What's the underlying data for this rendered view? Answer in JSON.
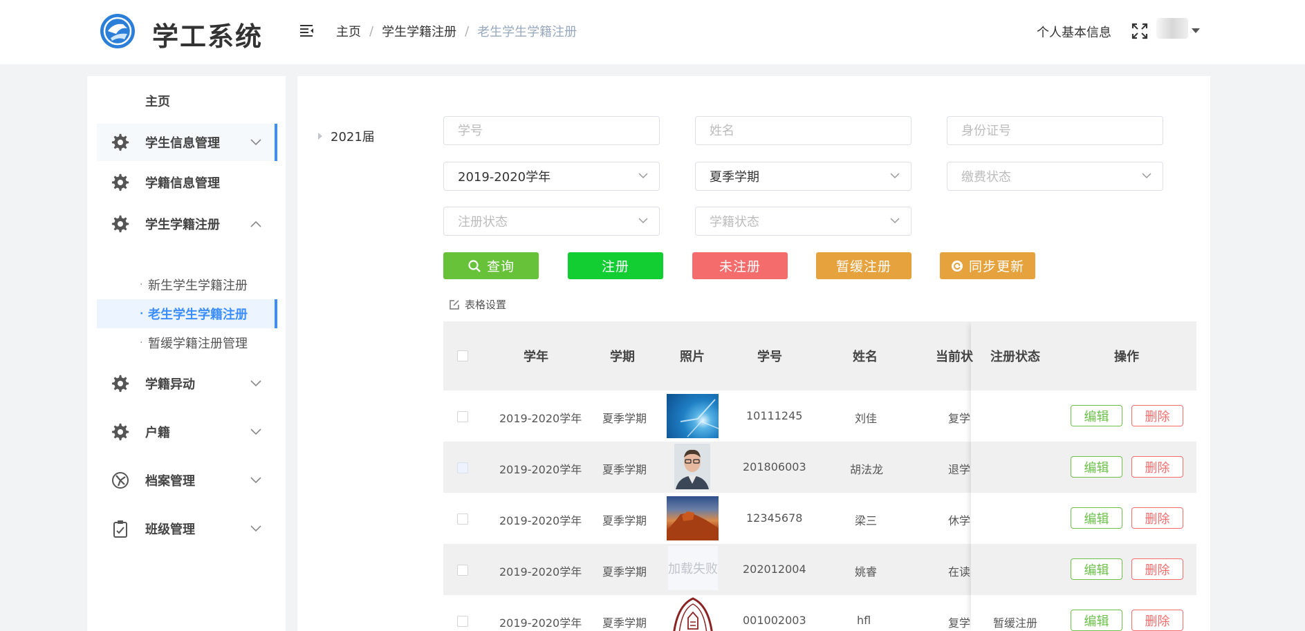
{
  "header": {
    "app_title": "学工系统",
    "breadcrumb": [
      "主页",
      "学生学籍注册",
      "老生学生学籍注册"
    ],
    "profile_link": "个人基本信息"
  },
  "sidebar": {
    "items": [
      {
        "label": "主页"
      },
      {
        "label": "学生信息管理"
      },
      {
        "label": "学籍信息管理"
      },
      {
        "label": "学生学籍注册"
      },
      {
        "label": "学籍异动"
      },
      {
        "label": "户籍"
      },
      {
        "label": "档案管理"
      },
      {
        "label": "班级管理"
      }
    ],
    "subitems": [
      {
        "label": "新生学生学籍注册"
      },
      {
        "label": "老生学生学籍注册"
      },
      {
        "label": "暂缓学籍注册管理"
      }
    ]
  },
  "tree": {
    "node": "2021届"
  },
  "filters": {
    "student_no_placeholder": "学号",
    "name_placeholder": "姓名",
    "id_card_placeholder": "身份证号",
    "school_year_value": "2019-2020学年",
    "semester_value": "夏季学期",
    "payment_placeholder": "缴费状态",
    "register_status_placeholder": "注册状态",
    "enroll_status_placeholder": "学籍状态"
  },
  "buttons": {
    "query": "查询",
    "register": "注册",
    "unregistered": "未注册",
    "defer": "暂缓注册",
    "sync": "同步更新"
  },
  "table_settings": "表格设置",
  "table": {
    "headers": {
      "year": "学年",
      "semester": "学期",
      "photo": "照片",
      "student_no": "学号",
      "name": "姓名",
      "current_status": "当前状",
      "register_status": "注册状态",
      "actions": "操作"
    },
    "rows": [
      {
        "year": "2019-2020学年",
        "semester": "夏季学期",
        "student_no": "10111245",
        "name": "刘佳",
        "current_status": "复学",
        "register_status": "",
        "edit": "编辑",
        "delete": "删除"
      },
      {
        "year": "2019-2020学年",
        "semester": "夏季学期",
        "student_no": "201806003",
        "name": "胡法龙",
        "current_status": "退学",
        "register_status": "",
        "edit": "编辑",
        "delete": "删除"
      },
      {
        "year": "2019-2020学年",
        "semester": "夏季学期",
        "student_no": "12345678",
        "name": "梁三",
        "current_status": "休学",
        "register_status": "",
        "edit": "编辑",
        "delete": "删除"
      },
      {
        "year": "2019-2020学年",
        "semester": "夏季学期",
        "student_no": "202012004",
        "name": "姚睿",
        "current_status": "在读",
        "register_status": "",
        "photo_text": "加载失败",
        "edit": "编辑",
        "delete": "删除"
      },
      {
        "year": "2019-2020学年",
        "semester": "夏季学期",
        "student_no": "001002003",
        "name": "hfl",
        "current_status": "复学",
        "register_status": "暂缓注册",
        "edit": "编辑",
        "delete": "删除"
      }
    ]
  },
  "colors": {
    "accent": "#3c8dff",
    "query_btn": "#67c23a",
    "register_btn": "#13ce33",
    "unregistered_btn": "#f56c6c",
    "defer_btn": "#e6a23c",
    "sync_btn": "#e6a23c"
  }
}
